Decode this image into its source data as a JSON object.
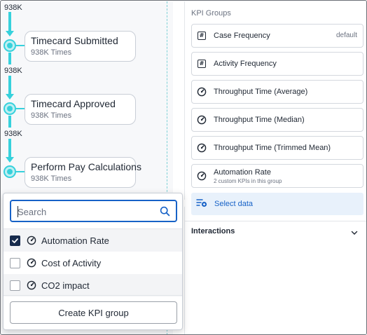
{
  "process": {
    "edges": [
      "938K",
      "938K",
      "938K"
    ],
    "nodes": [
      {
        "title": "Timecard Submitted",
        "sub": "938K Times"
      },
      {
        "title": "Timecard Approved",
        "sub": "938K Times"
      },
      {
        "title": "Perform Pay Calculations",
        "sub": "938K Times"
      }
    ]
  },
  "panel": {
    "group_title": "KPI Groups",
    "kpis": [
      {
        "label": "Case Frequency",
        "badge": "default",
        "icon": "hash-icon"
      },
      {
        "label": "Activity Frequency",
        "icon": "hash-icon"
      },
      {
        "label": "Throughput Time (Average)",
        "icon": "gauge-icon"
      },
      {
        "label": "Throughput Time (Median)",
        "icon": "gauge-icon"
      },
      {
        "label": "Throughput Time (Trimmed Mean)",
        "icon": "gauge-icon"
      },
      {
        "label": "Automation Rate",
        "sub": "2 custom KPIs in this group",
        "icon": "gauge-icon"
      }
    ],
    "select_data": "Select data",
    "interactions": "Interactions"
  },
  "dropdown": {
    "search_placeholder": "Search",
    "options": [
      {
        "label": "Automation Rate",
        "checked": true
      },
      {
        "label": "Cost of Activity",
        "checked": false
      },
      {
        "label": "CO2 impact",
        "checked": false
      }
    ],
    "create_button": "Create KPI group"
  },
  "colors": {
    "accent": "#1762c7",
    "flow": "#36d1dc",
    "checkbox_on": "#172b4d"
  }
}
